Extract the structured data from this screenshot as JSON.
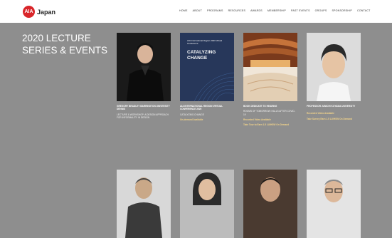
{
  "logo": {
    "mark": "AIA",
    "name": "Japan"
  },
  "nav": [
    "HOME",
    "ABOUT",
    "PROGRAMS",
    "RESOURCES",
    "AWARDS",
    "MEMBERSHIP",
    "PAST EVENTS",
    "GROUPS",
    "SPONSORSHIP",
    "CONTACT"
  ],
  "page_title": "2020 LECTURE SERIES & EVENTS",
  "cards": [
    {
      "title": "GREGORY BRADLEY BARRINGTON UNIVERSITY DENNIS",
      "type": "LECTURE & WORKSHOP: A DESIGN APPROACH FOR INFORMALITY IN DESIGN",
      "link": ""
    },
    {
      "cover_small": "AIA International Region 2020 Virtual Conference",
      "cover_big": "CATALYZING CHANGE",
      "title": "AIA INTERNATIONAL REGION VIRTUAL CONFERENCE 2020",
      "type": "CATALYZING CHANGE",
      "link": "On-demand Available"
    },
    {
      "title": "BOOK DEDICATE TO HEARING",
      "type": "ROOMS OF TOMORROW: HALLS AFTER COVID-19",
      "link": "Recorded Video Available",
      "link2": "Take Tour to Earn 1.5 LU/HSW On Demand"
    },
    {
      "title": "PROFESSOR JUNICHI KOYAMA UNIVERSITY",
      "type": "",
      "link": "Recorded Video Available",
      "link2": "Take Survey Earn 1.5 LU/HSW On Demand"
    }
  ],
  "colors": {
    "background": "#8e8e8e",
    "accent": "#d9262a",
    "link": "#f5d58a"
  }
}
